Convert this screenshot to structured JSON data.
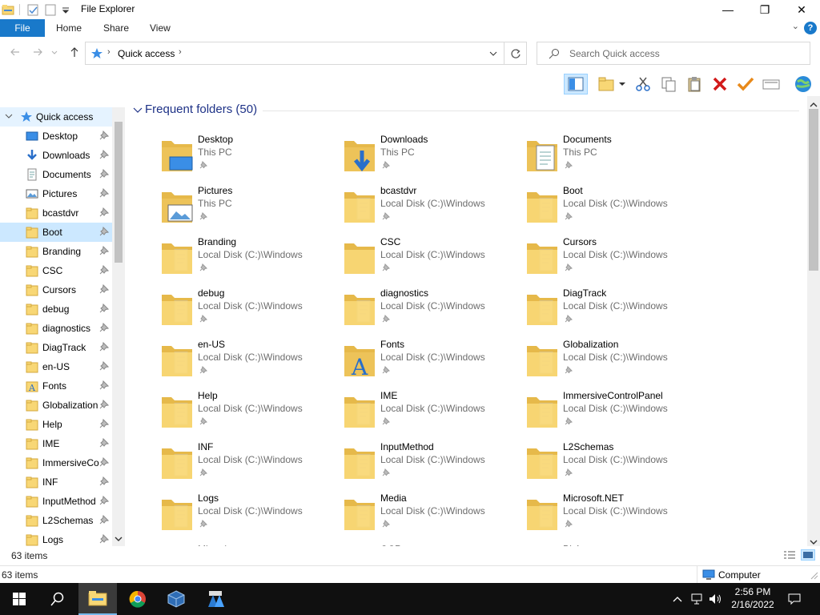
{
  "window": {
    "title": "File Explorer",
    "minimize_glyph": "—",
    "maximize_glyph": "❐",
    "close_glyph": "✕"
  },
  "ribbon": {
    "tabs": [
      "File",
      "Home",
      "Share",
      "View"
    ],
    "help_glyph": "?",
    "collapse_glyph": "⌄"
  },
  "address": {
    "location": "Quick access",
    "search_placeholder": "Search Quick access"
  },
  "sidebar": {
    "root": "Quick access",
    "items": [
      {
        "label": "Desktop",
        "icon": "desktop-icon"
      },
      {
        "label": "Downloads",
        "icon": "downloads-icon"
      },
      {
        "label": "Documents",
        "icon": "documents-icon"
      },
      {
        "label": "Pictures",
        "icon": "pictures-icon"
      },
      {
        "label": "bcastdvr",
        "icon": "folder-icon"
      },
      {
        "label": "Boot",
        "icon": "folder-icon",
        "selected": true
      },
      {
        "label": "Branding",
        "icon": "folder-icon"
      },
      {
        "label": "CSC",
        "icon": "folder-icon"
      },
      {
        "label": "Cursors",
        "icon": "folder-icon"
      },
      {
        "label": "debug",
        "icon": "folder-icon"
      },
      {
        "label": "diagnostics",
        "icon": "folder-icon"
      },
      {
        "label": "DiagTrack",
        "icon": "folder-icon"
      },
      {
        "label": "en-US",
        "icon": "folder-icon"
      },
      {
        "label": "Fonts",
        "icon": "fonts-icon"
      },
      {
        "label": "Globalization",
        "icon": "folder-icon"
      },
      {
        "label": "Help",
        "icon": "folder-icon"
      },
      {
        "label": "IME",
        "icon": "folder-icon"
      },
      {
        "label": "ImmersiveCo",
        "icon": "folder-icon"
      },
      {
        "label": "INF",
        "icon": "folder-icon"
      },
      {
        "label": "InputMethod",
        "icon": "folder-icon"
      },
      {
        "label": "L2Schemas",
        "icon": "folder-icon"
      },
      {
        "label": "Logs",
        "icon": "folder-icon"
      }
    ]
  },
  "content": {
    "group_header": "Frequent folders (50)",
    "folders": [
      {
        "name": "Desktop",
        "location": "This PC",
        "overlay": "desktop"
      },
      {
        "name": "Downloads",
        "location": "This PC",
        "overlay": "download"
      },
      {
        "name": "Documents",
        "location": "This PC",
        "overlay": "document"
      },
      {
        "name": "Pictures",
        "location": "This PC",
        "overlay": "picture"
      },
      {
        "name": "bcastdvr",
        "location": "Local Disk (C:)\\Windows",
        "overlay": "paper"
      },
      {
        "name": "Boot",
        "location": "Local Disk (C:)\\Windows",
        "overlay": "paper"
      },
      {
        "name": "Branding",
        "location": "Local Disk (C:)\\Windows",
        "overlay": "paper"
      },
      {
        "name": "CSC",
        "location": "Local Disk (C:)\\Windows",
        "overlay": "none"
      },
      {
        "name": "Cursors",
        "location": "Local Disk (C:)\\Windows",
        "overlay": "paper"
      },
      {
        "name": "debug",
        "location": "Local Disk (C:)\\Windows",
        "overlay": "paper"
      },
      {
        "name": "diagnostics",
        "location": "Local Disk (C:)\\Windows",
        "overlay": "paper"
      },
      {
        "name": "DiagTrack",
        "location": "Local Disk (C:)\\Windows",
        "overlay": "paper"
      },
      {
        "name": "en-US",
        "location": "Local Disk (C:)\\Windows",
        "overlay": "paper"
      },
      {
        "name": "Fonts",
        "location": "Local Disk (C:)\\Windows",
        "overlay": "font"
      },
      {
        "name": "Globalization",
        "location": "Local Disk (C:)\\Windows",
        "overlay": "paper"
      },
      {
        "name": "Help",
        "location": "Local Disk (C:)\\Windows",
        "overlay": "paper"
      },
      {
        "name": "IME",
        "location": "Local Disk (C:)\\Windows",
        "overlay": "paper"
      },
      {
        "name": "ImmersiveControlPanel",
        "location": "Local Disk (C:)\\Windows",
        "overlay": "paper"
      },
      {
        "name": "INF",
        "location": "Local Disk (C:)\\Windows",
        "overlay": "paper"
      },
      {
        "name": "InputMethod",
        "location": "Local Disk (C:)\\Windows",
        "overlay": "paper"
      },
      {
        "name": "L2Schemas",
        "location": "Local Disk (C:)\\Windows",
        "overlay": "paper"
      },
      {
        "name": "Logs",
        "location": "Local Disk (C:)\\Windows",
        "overlay": "paper"
      },
      {
        "name": "Media",
        "location": "Local Disk (C:)\\Windows",
        "overlay": "paper"
      },
      {
        "name": "Microsoft.NET",
        "location": "Local Disk (C:)\\Windows",
        "overlay": "paper"
      },
      {
        "name": "Migration",
        "location": "",
        "overlay": "paper"
      },
      {
        "name": "OCR",
        "location": "",
        "overlay": "paper"
      },
      {
        "name": "PLA",
        "location": "",
        "overlay": "paper"
      }
    ]
  },
  "status": {
    "items_top": "63 items",
    "items_bottom": "63 items",
    "computer": "Computer"
  },
  "taskbar": {
    "time": "2:56 PM",
    "date": "2/16/2022"
  },
  "colors": {
    "accent": "#1979ca",
    "folder": "#f8d775",
    "folder_dark": "#e6b94a",
    "header_blue": "#1e3287",
    "selected": "#cce8ff",
    "taskbar": "#101010"
  }
}
